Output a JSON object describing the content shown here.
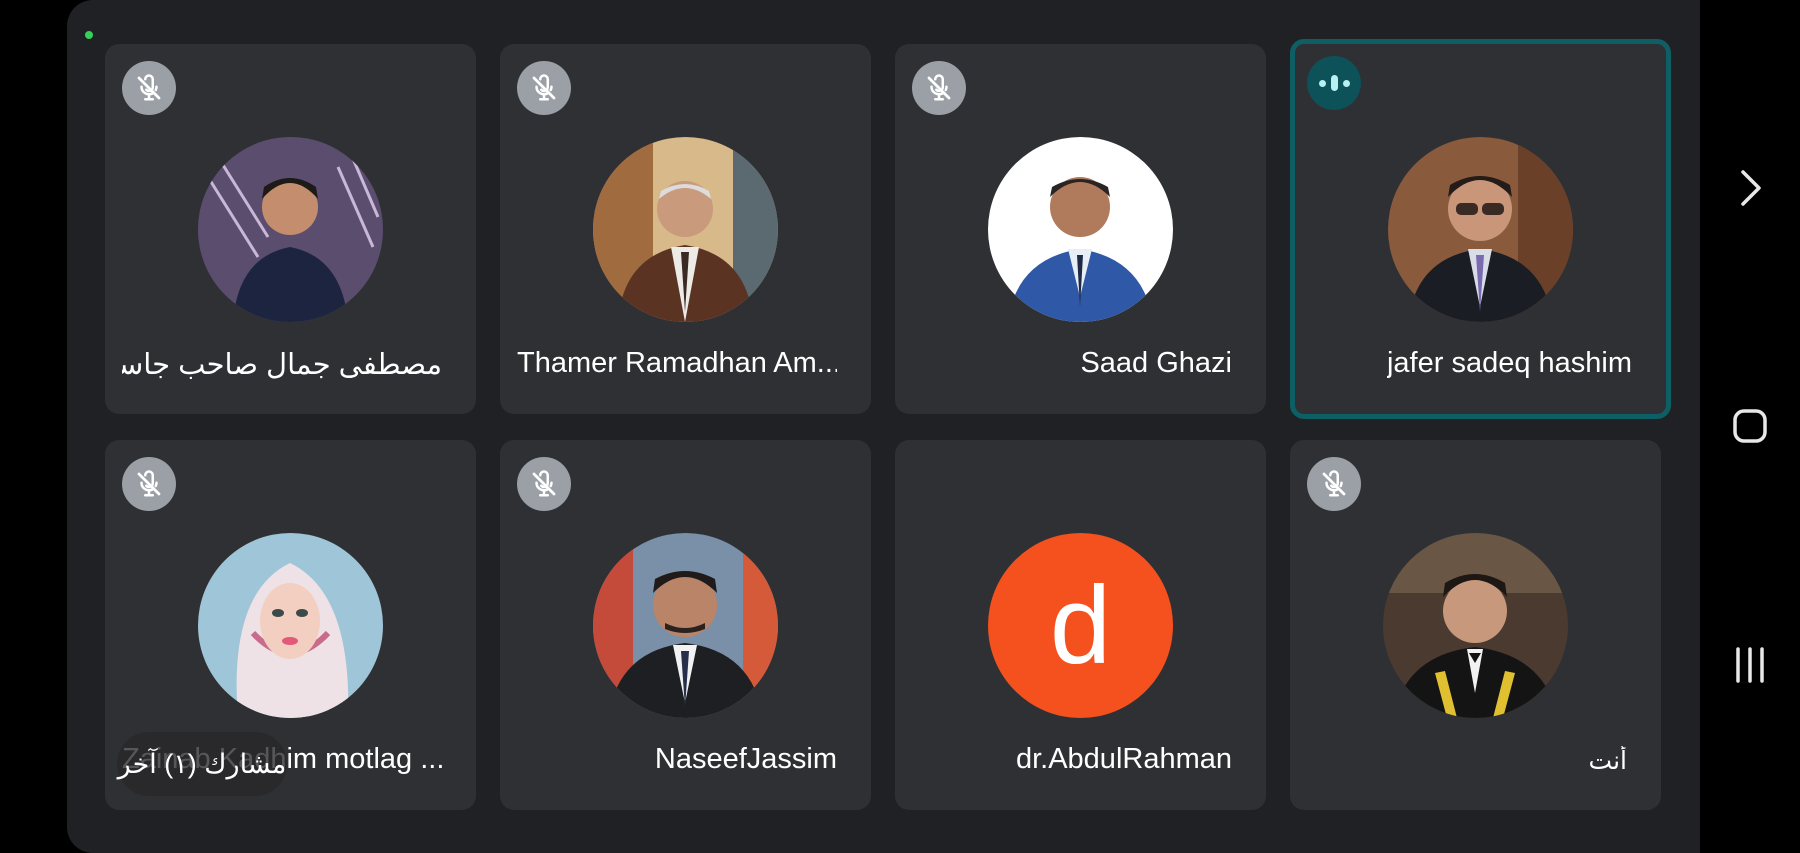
{
  "participants": [
    {
      "name": "مصطفى جمال  صاحب جاسم",
      "muted": true
    },
    {
      "name": "Thamer Ramadhan Am...",
      "muted": true
    },
    {
      "name": "Saad Ghazi",
      "muted": true
    },
    {
      "name": "jafer sadeq hashim",
      "muted": false,
      "speaking": true
    },
    {
      "name": "Zainab Kadhim motlag ...",
      "muted": true
    },
    {
      "name": "NaseefJassim",
      "muted": true
    },
    {
      "name": "dr.AbdulRahman",
      "muted": false,
      "avatar_letter": "d"
    },
    {
      "name": "أنت",
      "muted": true
    }
  ],
  "others_pill": {
    "label": "مشارك (١) آخر"
  },
  "nav": {
    "next_icon": "chevron-right-icon",
    "home_icon": "home-icon",
    "recents_icon": "recents-icon"
  },
  "colors": {
    "background": "#202124",
    "tile": "#2f3034",
    "active_border": "#0e5e66",
    "letter_avatar": "#f4511e",
    "recording_dot": "#34d058"
  }
}
